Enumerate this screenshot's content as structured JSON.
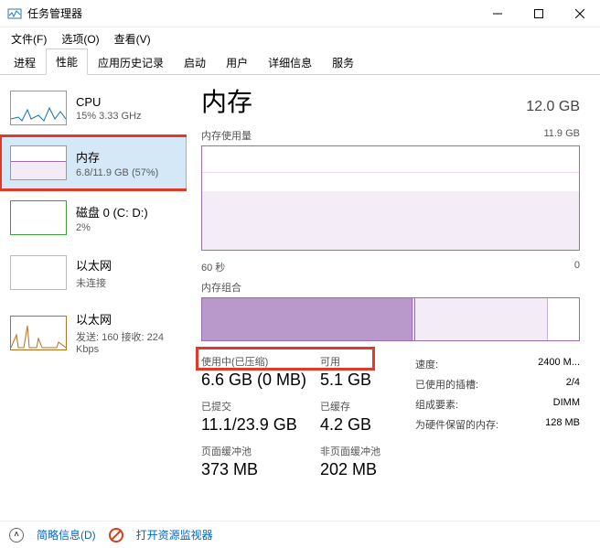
{
  "window": {
    "title": "任务管理器",
    "menu": {
      "file": "文件(F)",
      "options": "选项(O)",
      "view": "查看(V)"
    }
  },
  "tabs": [
    "进程",
    "性能",
    "应用历史记录",
    "启动",
    "用户",
    "详细信息",
    "服务"
  ],
  "active_tab": 1,
  "sidebar": {
    "items": [
      {
        "name": "CPU",
        "sub": "15% 3.33 GHz"
      },
      {
        "name": "内存",
        "sub": "6.8/11.9 GB (57%)"
      },
      {
        "name": "磁盘 0 (C: D:)",
        "sub": "2%"
      },
      {
        "name": "以太网",
        "sub": "未连接"
      },
      {
        "name": "以太网",
        "sub": "发送: 160 接收: 224 Kbps"
      }
    ],
    "selected": 1
  },
  "detail": {
    "title": "内存",
    "capacity": "12.0 GB",
    "usage_label": "内存使用量",
    "usage_max": "11.9 GB",
    "time_axis": {
      "left": "60 秒",
      "right": "0"
    },
    "compo_label": "内存组合",
    "stats_left": [
      {
        "label": "使用中(已压缩)",
        "value": "6.6 GB (0 MB)"
      },
      {
        "label": "可用",
        "value": "5.1 GB"
      },
      {
        "label": "已提交",
        "value": "11.1/23.9 GB"
      },
      {
        "label": "已缓存",
        "value": "4.2 GB"
      },
      {
        "label": "页面缓冲池",
        "value": "373 MB"
      },
      {
        "label": "非页面缓冲池",
        "value": "202 MB"
      }
    ],
    "stats_right": [
      {
        "label": "速度:",
        "value": "2400 M..."
      },
      {
        "label": "已使用的插槽:",
        "value": "2/4"
      },
      {
        "label": "组成要素:",
        "value": "DIMM"
      },
      {
        "label": "为硬件保留的内存:",
        "value": "128 MB"
      }
    ]
  },
  "footer": {
    "fewer": "简略信息(D)",
    "resmon": "打开资源监视器"
  },
  "chart_data": {
    "type": "area",
    "title": "内存使用量",
    "ylabel": "GB",
    "ylim": [
      0,
      11.9
    ],
    "x": [
      60,
      55,
      50,
      45,
      40,
      35,
      30,
      25,
      20,
      15,
      10,
      5,
      0
    ],
    "values": [
      6.8,
      6.8,
      6.8,
      6.8,
      6.8,
      6.8,
      6.8,
      6.8,
      6.8,
      6.8,
      6.8,
      6.8,
      6.8
    ],
    "composition": {
      "in_use_gb": 6.6,
      "modified_gb": 0.1,
      "standby_gb": 4.2,
      "free_gb": 1.0,
      "total_gb": 11.9
    }
  }
}
